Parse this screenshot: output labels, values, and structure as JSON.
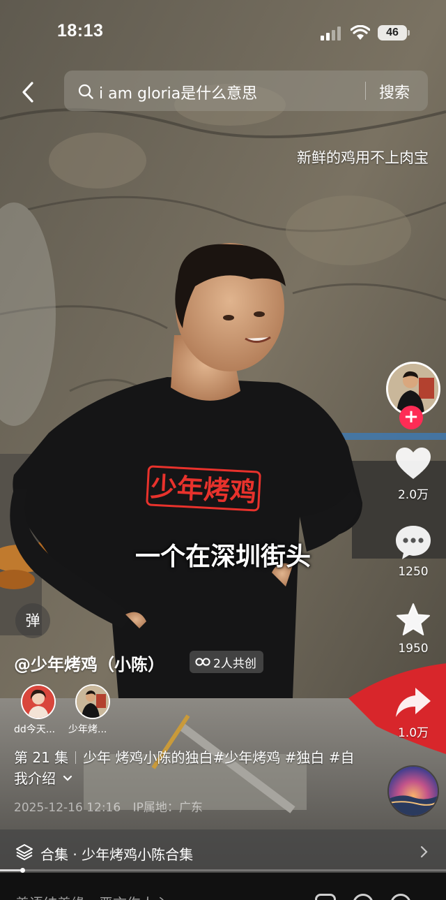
{
  "status_bar": {
    "time": "18:13",
    "battery": "46"
  },
  "search": {
    "query": "i am gloria是什么意思",
    "button_label": "搜索"
  },
  "danmaku": {
    "text": "新鲜的鸡用不上肉宝"
  },
  "video": {
    "shirt_text": "少年烤鸡",
    "subtitle": "一个在深圳街头"
  },
  "actions": {
    "likes": "2.0万",
    "comments": "1250",
    "favorites": "1950",
    "shares": "1.0万"
  },
  "post": {
    "danmaku_toggle": "弹",
    "author": "@少年烤鸡（小陈）",
    "cocreate_badge": "2人共创",
    "cocreators": [
      {
        "name": "dd今天..."
      },
      {
        "name": "少年烤..."
      }
    ],
    "episode": "第 21 集",
    "caption": "少年 烤鸡小陈的独白#少年烤鸡 #独白 #自我介绍",
    "date": "2025-12-16 12:16",
    "ip_location": "IP属地：广东"
  },
  "collection": {
    "label": "合集 · 少年烤鸡小陈合集"
  },
  "playback": {
    "progress": 0.05
  },
  "comment_bar": {
    "placeholder": "善语结善缘，恶言伤人心"
  },
  "colors": {
    "follow": "#fe2c55",
    "shirt_text": "#e8322c"
  }
}
